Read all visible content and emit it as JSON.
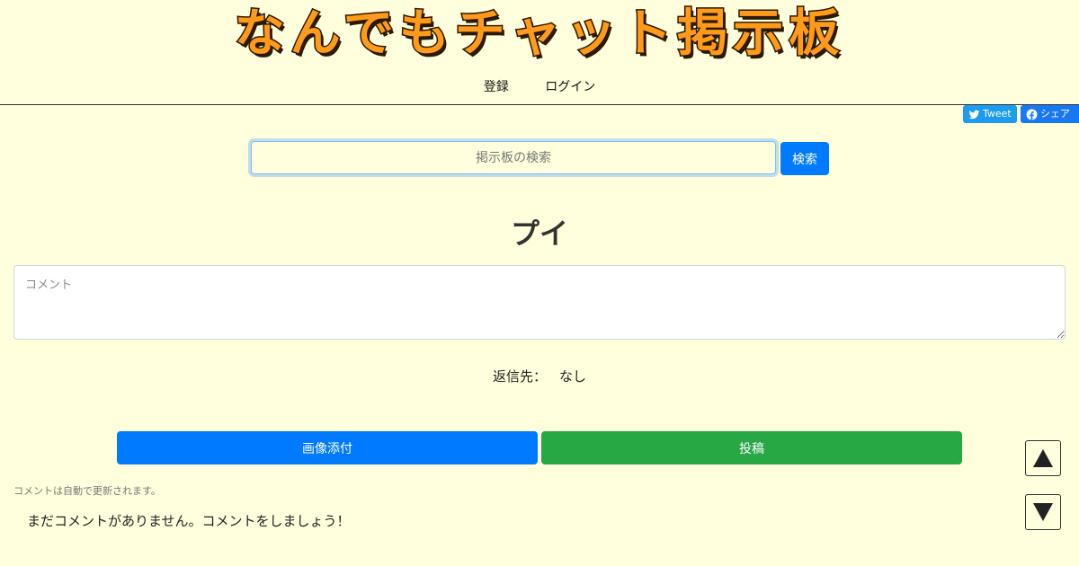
{
  "header": {
    "site_title": "なんでもチャット掲示板",
    "nav": {
      "register": "登録",
      "login": "ログイン"
    }
  },
  "share": {
    "tweet_label": "Tweet",
    "facebook_label": "シェア"
  },
  "search": {
    "placeholder": "掲示板の検索",
    "button_label": "検索"
  },
  "board": {
    "title": "プイ"
  },
  "comment_form": {
    "placeholder": "コメント",
    "reply_label": "返信先：",
    "reply_value": "なし",
    "attach_image_label": "画像添付",
    "post_label": "投稿"
  },
  "comments": {
    "auto_update_note": "コメントは自動で更新されます。",
    "empty_message": "まだコメントがありません。コメントをしましょう！"
  },
  "colors": {
    "background": "#ffffdd",
    "primary": "#007bff",
    "success": "#28a745",
    "title_orange": "#ff9a1a"
  }
}
